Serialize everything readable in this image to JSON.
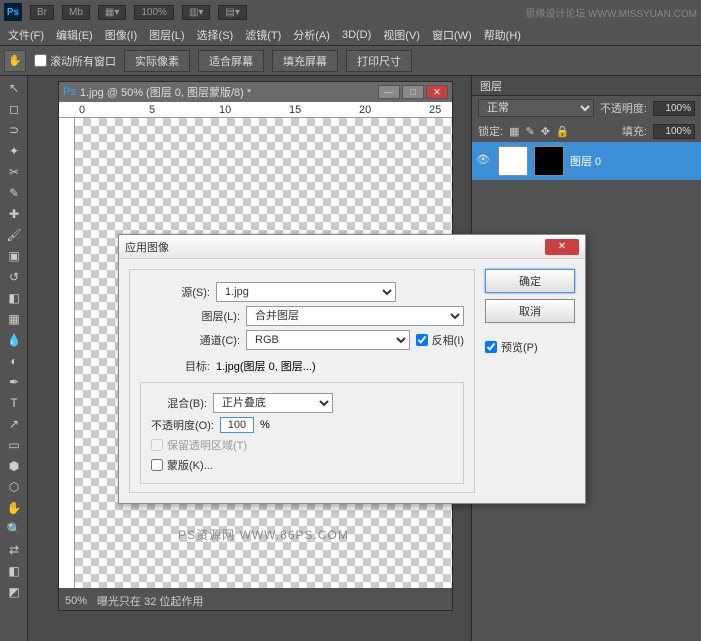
{
  "topbar": {
    "br": "Br",
    "mb": "Mb",
    "zoom": "100%",
    "site": "思缘设计论坛 WWW.MISSYUAN.COM"
  },
  "menu": {
    "file": "文件(F)",
    "edit": "编辑(E)",
    "image": "图像(I)",
    "layer": "图层(L)",
    "select": "选择(S)",
    "filter": "滤镜(T)",
    "analysis": "分析(A)",
    "threeD": "3D(D)",
    "view": "视图(V)",
    "window": "窗口(W)",
    "help": "帮助(H)"
  },
  "opt": {
    "scroll": "滚动所有窗口",
    "actual": "实际像素",
    "fit": "适合屏幕",
    "fill": "填充屏幕",
    "print": "打印尺寸"
  },
  "doc": {
    "title": "1.jpg @ 50% (图层 0, 图层蒙版/8) *",
    "status_zoom": "50%",
    "status_msg": "曝光只在 32 位起作用"
  },
  "watermark": "PS资源网 WWW.86PS.COM",
  "panel": {
    "tab": "图层",
    "mode": "正常",
    "opacity_label": "不透明度:",
    "opacity": "100%",
    "lock": "锁定:",
    "fill_label": "填充:",
    "fill": "100%",
    "layer_name": "图层 0"
  },
  "dialog": {
    "title": "应用图像",
    "source_label": "源(S):",
    "source": "1.jpg",
    "layer_label": "图层(L):",
    "layer": "合并图层",
    "channel_label": "通道(C):",
    "channel": "RGB",
    "invert": "反相(I)",
    "target_label": "目标:",
    "target": "1.jpg(图层 0, 图层...)",
    "blend_label": "混合(B):",
    "blend": "正片叠底",
    "opacity_label": "不透明度(O):",
    "opacity": "100",
    "pct": "%",
    "preserve": "保留透明区域(T)",
    "mask": "蒙版(K)...",
    "ok": "确定",
    "cancel": "取消",
    "preview": "预览(P)"
  },
  "ruler": {
    "r0": "0",
    "r5": "5",
    "r10": "10",
    "r15": "15",
    "r20": "20",
    "r25": "25"
  }
}
